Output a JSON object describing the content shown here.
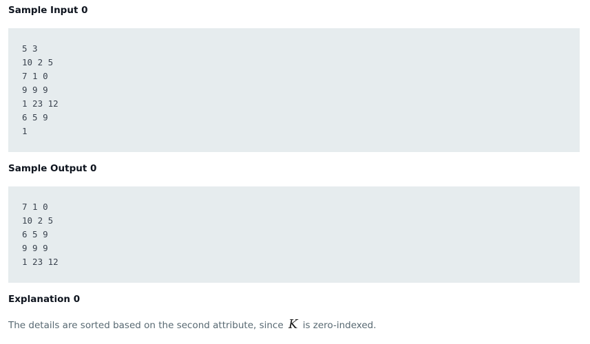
{
  "sample_input": {
    "heading": "Sample Input 0",
    "lines": [
      "5 3",
      "10 2 5",
      "7 1 0",
      "9 9 9",
      "1 23 12",
      "6 5 9",
      "1"
    ]
  },
  "sample_output": {
    "heading": "Sample Output 0",
    "lines": [
      "7 1 0",
      "10 2 5",
      "6 5 9",
      "9 9 9",
      "1 23 12"
    ]
  },
  "explanation": {
    "heading": "Explanation 0",
    "text_before": "The details are sorted based on the second attribute, since",
    "variable": "K",
    "text_after": "is zero-indexed."
  },
  "colors": {
    "code_background": "#e6ecee",
    "heading_text": "#0e141e",
    "body_text": "#576871"
  }
}
